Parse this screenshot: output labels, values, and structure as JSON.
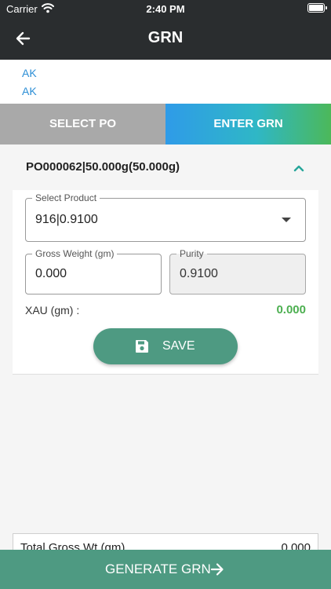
{
  "status_bar": {
    "carrier": "Carrier",
    "time": "2:40 PM"
  },
  "nav": {
    "title": "GRN",
    "back_icon": "arrow-left-icon"
  },
  "info": {
    "line1": "AK",
    "line2": "AK"
  },
  "tabs": [
    {
      "label": "SELECT PO",
      "active": false,
      "color": "#a9a9a9"
    },
    {
      "label": "ENTER GRN",
      "active": true
    }
  ],
  "po": {
    "label": "PO000062|50.000g(50.000g)",
    "expanded": true,
    "chevron_icon": "chevron-up-icon"
  },
  "form": {
    "product": {
      "label": "Select Product",
      "value": "916|0.9100"
    },
    "gross_weight": {
      "label": "Gross Weight (gm)",
      "value": "0.000"
    },
    "purity": {
      "label": "Purity",
      "value": "0.9100"
    },
    "xau": {
      "label": "XAU (gm) :",
      "value": "0.000",
      "color": "#4caf50"
    },
    "save_button": {
      "label": "SAVE",
      "icon": "floppy-disk-icon",
      "color": "#4e9a82"
    }
  },
  "totals": {
    "label": "Total Gross Wt (gm)",
    "value": "0.000"
  },
  "generate_button": {
    "label": "GENERATE GRN",
    "icon": "arrow-right-icon"
  },
  "colors": {
    "header_bg": "#2a2d2f",
    "link_blue": "#2d8fd6",
    "accent_teal": "#26a69a"
  }
}
